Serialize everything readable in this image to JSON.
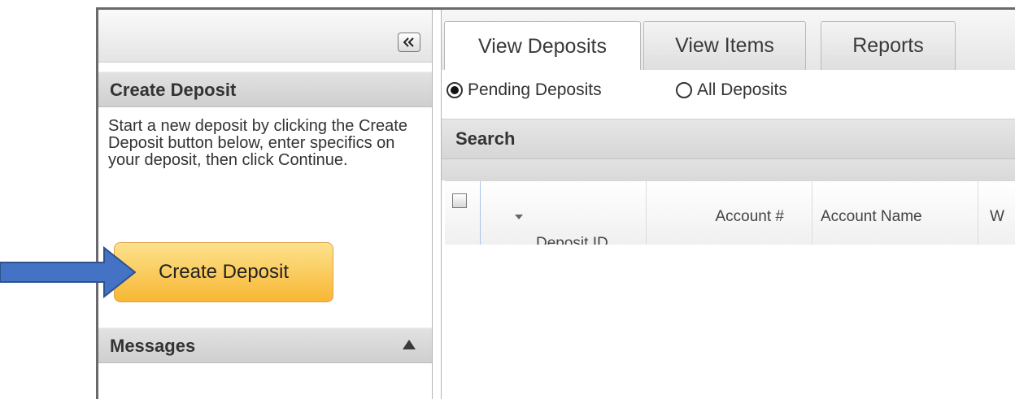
{
  "left_panel": {
    "collapse_icon": "double-chevron-left-icon",
    "create_section": {
      "title": "Create Deposit",
      "description": "Start a new deposit by clicking the Create Deposit button below, enter specifics on your deposit, then click Continue.",
      "button_label": "Create Deposit"
    },
    "messages_section": {
      "title": "Messages",
      "toggle_icon": "triangle-up-icon"
    }
  },
  "tabs": [
    {
      "label": "View Deposits",
      "active": true
    },
    {
      "label": "View Items",
      "active": false
    },
    {
      "label": "Reports",
      "active": false
    }
  ],
  "filter": {
    "options": [
      {
        "label": "Pending Deposits",
        "checked": true
      },
      {
        "label": "All Deposits",
        "checked": false
      }
    ]
  },
  "search": {
    "label": "Search"
  },
  "grid": {
    "columns": [
      "Deposit ID",
      "Account #",
      "Account Name",
      "W"
    ],
    "sort_icon": "caret-down-icon",
    "rows": []
  },
  "annotation": {
    "arrow_icon": "arrow-right-icon",
    "arrow_color": "#4472c4"
  },
  "colors": {
    "button_top": "#fde28c",
    "button_bottom": "#f7b733",
    "frame": "#6a6a6a"
  }
}
